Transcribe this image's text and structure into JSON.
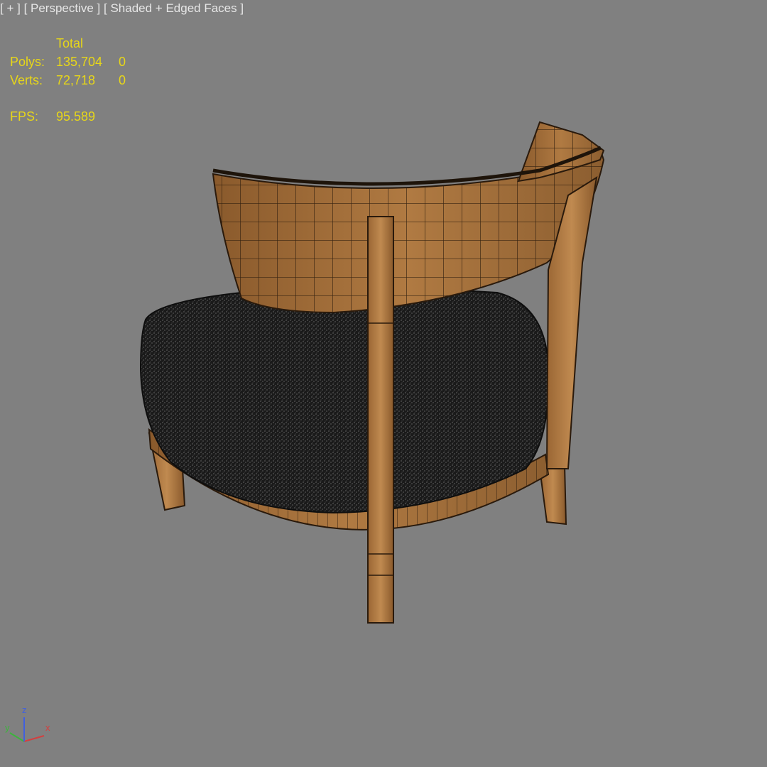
{
  "viewport": {
    "menu_label": "[ + ]",
    "view_label": "[ Perspective ]",
    "shading_label": "[ Shaded + Edged Faces ]"
  },
  "stats": {
    "header": "Total",
    "polys_label": "Polys:",
    "polys_total": "135,704",
    "polys_selected": "0",
    "verts_label": "Verts:",
    "verts_total": "72,718",
    "verts_selected": "0",
    "fps_label": "FPS:",
    "fps_value": "95.589"
  },
  "axis_gizmo": {
    "x": "x",
    "y": "y",
    "z": "z"
  },
  "colors": {
    "viewport_bg": "#808080",
    "stats_text": "#e7d619",
    "label_text": "#e6e6e6",
    "wood": "#a8743f",
    "cushion": "#1c1c1c",
    "axis_x": "#d24040",
    "axis_y": "#3cb43c",
    "axis_z": "#4060e0"
  },
  "model": {
    "name": "armchair-wireframe-model"
  }
}
